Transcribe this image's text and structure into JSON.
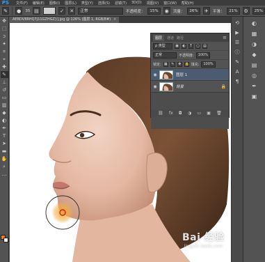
{
  "app": {
    "logo": "PS"
  },
  "menu": [
    "文件(F)",
    "编辑(E)",
    "图像(I)",
    "图层(L)",
    "类型(Y)",
    "选择(S)",
    "滤镜(T)",
    "3D(D)",
    "视图(V)",
    "窗口(W)",
    "帮助(H)"
  ],
  "options_bar": {
    "brush_size": "35",
    "mode_value": "正常",
    "opacity_label": "不透明度：",
    "opacity_value": "15%",
    "flow_label": "流量：",
    "flow_value": "26%",
    "strength_label": "平滑：",
    "strength_value": "21%",
    "extra_value": "25%",
    "icons": [
      "brush-tool-icon",
      "brush-size-icon",
      "brush-panel-icon",
      "tablet-pressure-icon",
      "airbrush-icon"
    ]
  },
  "document": {
    "tab_label": "AEBDV8RHQ7J11GZHGZ}].jpg @ 126% (图层 1, RGB/8#)",
    "close": "×"
  },
  "layers_panel": {
    "tabs": [
      "图层",
      "通道",
      "路径"
    ],
    "active_tab": "图层",
    "filter_label": "ρ 类型",
    "blend_mode": "正常",
    "opacity_label": "不透明度:",
    "opacity_value": "100%",
    "lock_label": "锁定:",
    "fill_label": "填充:",
    "fill_value": "100%",
    "layers": [
      {
        "name": "图层 1",
        "visible": true,
        "selected": true,
        "locked": false
      },
      {
        "name": "背景",
        "visible": true,
        "selected": false,
        "locked": true
      }
    ],
    "footer_icons": [
      "link-icon",
      "fx-icon",
      "mask-icon",
      "adjustment-icon",
      "group-icon",
      "new-layer-icon",
      "trash-icon"
    ]
  },
  "colors": {
    "foreground": "#f07d1a",
    "background": "#ffffff",
    "accent": "#33a1fd"
  },
  "watermark": {
    "text": "Bai 经验",
    "url": "jingyan.baidu.com"
  }
}
